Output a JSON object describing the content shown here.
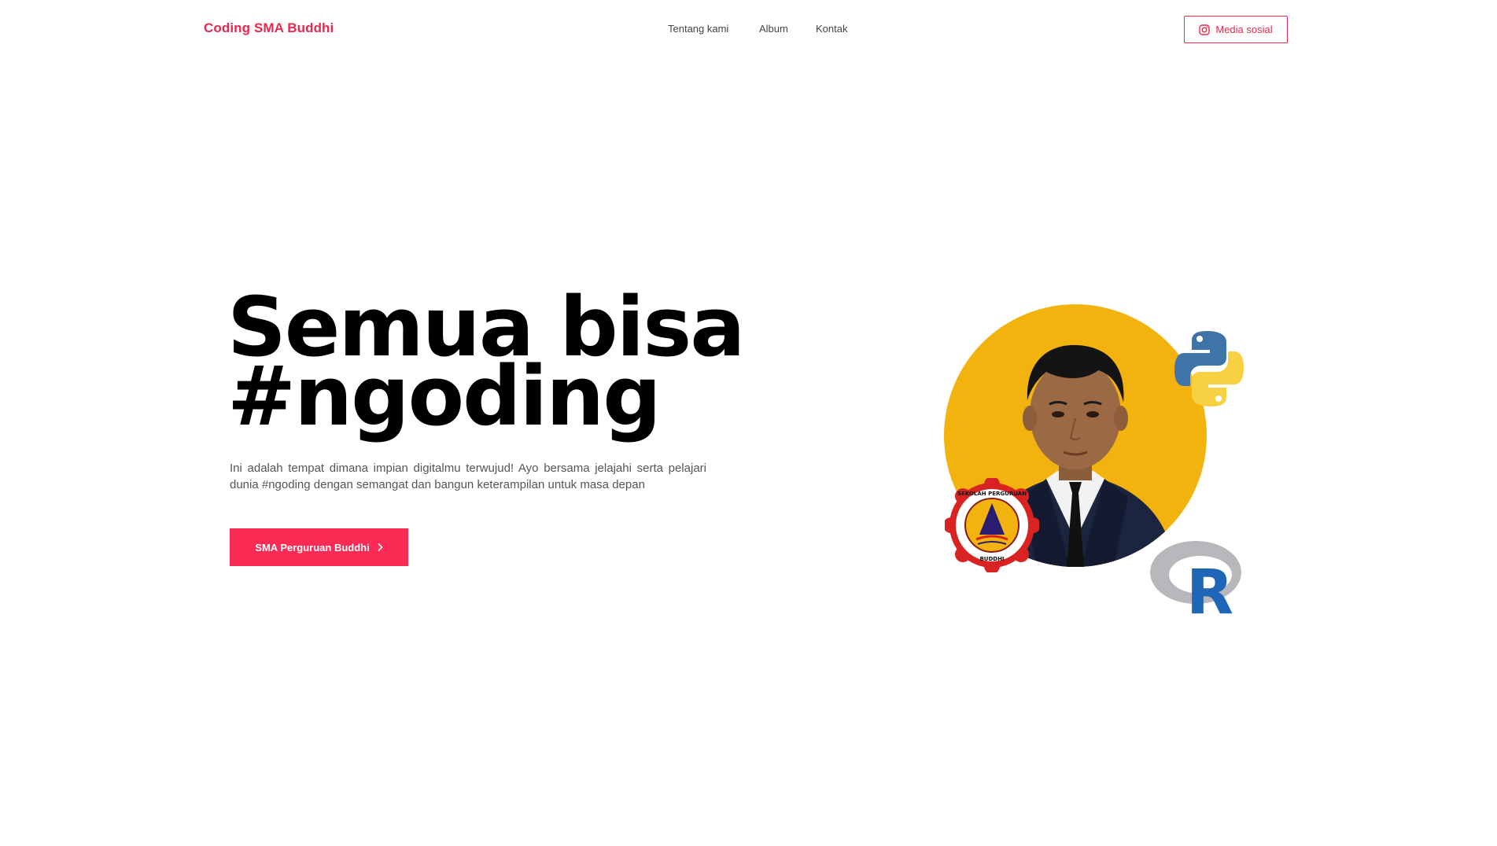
{
  "header": {
    "brand": "Coding SMA Buddhi",
    "nav": [
      {
        "label": "Tentang kami"
      },
      {
        "label": "Album"
      },
      {
        "label": "Kontak"
      }
    ],
    "social_button": {
      "label": "Media sosial",
      "icon": "instagram-icon"
    }
  },
  "hero": {
    "title_line1": "Semua bisa",
    "title_line2": "#ngoding",
    "description": "Ini adalah tempat dimana impian digitalmu terwujud! Ayo bersama jelajahi serta pelajari dunia #ngoding dengan semangat dan bangun keterampilan untuk masa depan",
    "cta": {
      "label": "SMA Perguruan Buddhi",
      "icon": "chevron-right-icon"
    }
  },
  "illustration": {
    "photo_icon": "person-portrait",
    "logos": [
      "python-logo",
      "r-logo",
      "school-seal"
    ],
    "seal_text_top": "SEKOLAH PERGURUAN",
    "seal_text_bottom": "BUDDHI",
    "r_letter": "R"
  },
  "colors": {
    "accent": "#e8294f",
    "cta_bg": "#fb2b55",
    "circle_bg": "#f3b30e",
    "text_dark": "#000000",
    "text_muted": "#555555"
  }
}
